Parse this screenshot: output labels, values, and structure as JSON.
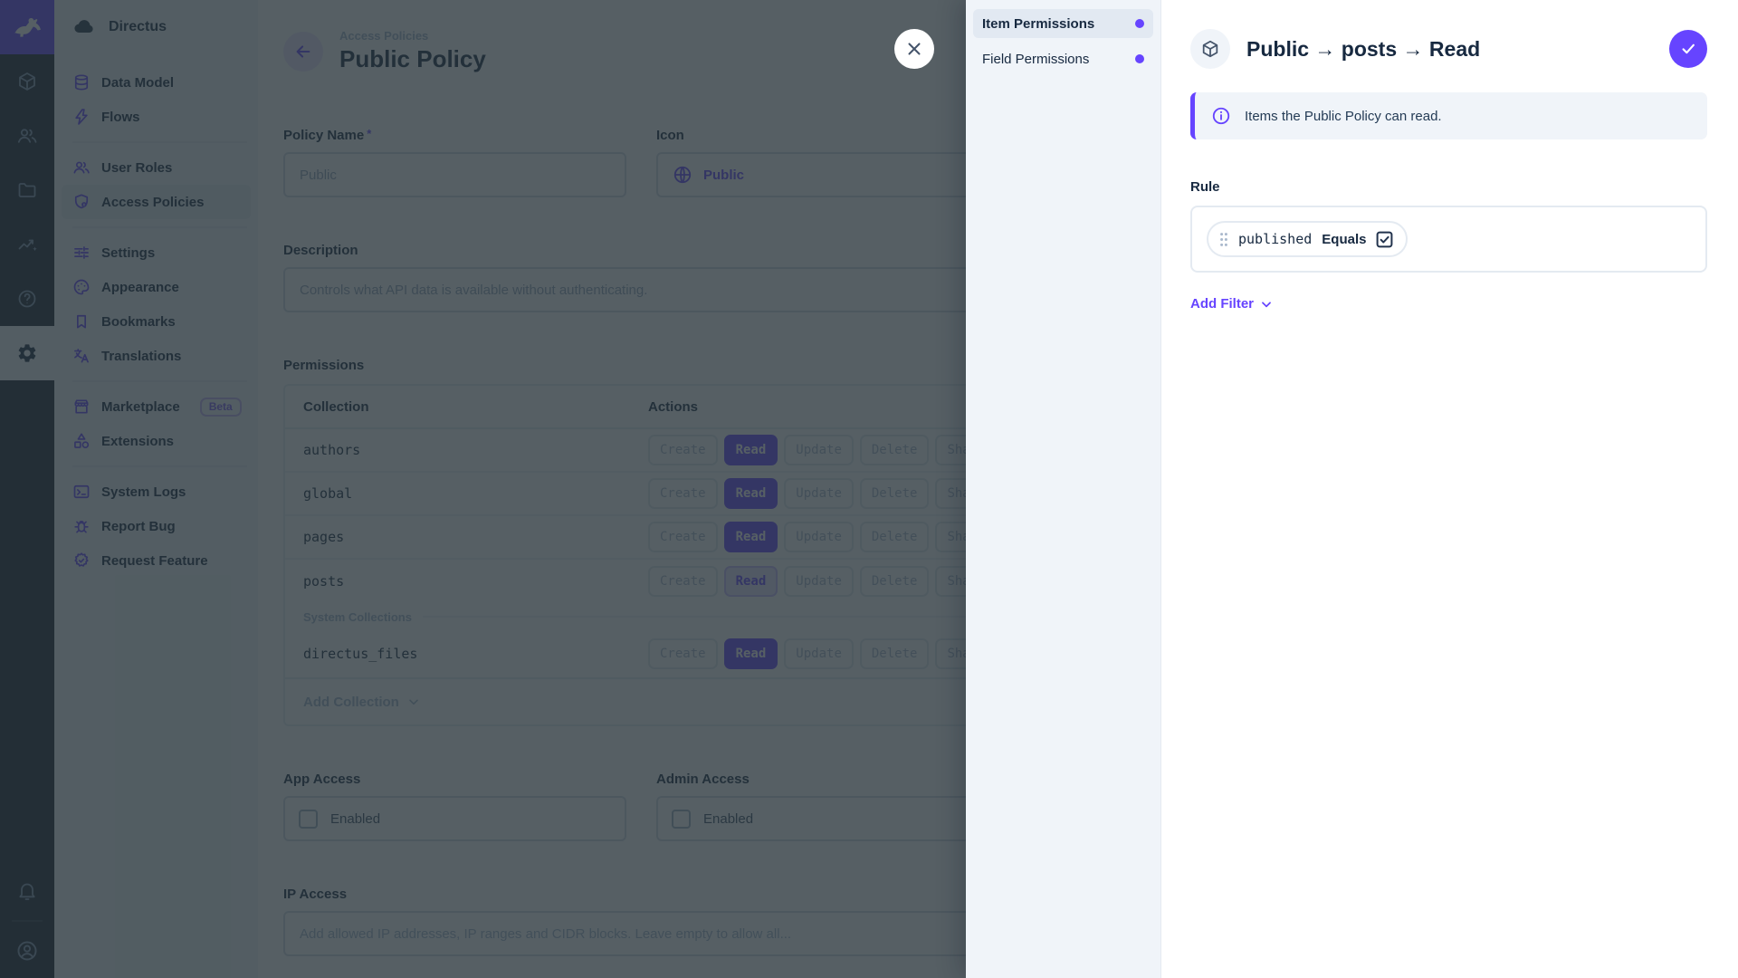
{
  "app": {
    "project_name": "Directus"
  },
  "nav": {
    "items": [
      {
        "label": "Data Model",
        "icon": "database-icon"
      },
      {
        "label": "Flows",
        "icon": "bolt-icon"
      },
      {
        "label": "User Roles",
        "icon": "users-icon"
      },
      {
        "label": "Access Policies",
        "icon": "shield-lock-icon",
        "active": true
      },
      {
        "label": "Settings",
        "icon": "tune-icon"
      },
      {
        "label": "Appearance",
        "icon": "palette-icon"
      },
      {
        "label": "Bookmarks",
        "icon": "bookmark-icon"
      },
      {
        "label": "Translations",
        "icon": "translate-icon"
      },
      {
        "label": "Marketplace",
        "icon": "storefront-icon",
        "badge": "Beta"
      },
      {
        "label": "Extensions",
        "icon": "category-icon"
      },
      {
        "label": "System Logs",
        "icon": "terminal-icon"
      },
      {
        "label": "Report Bug",
        "icon": "bug-icon"
      },
      {
        "label": "Request Feature",
        "icon": "feature-seal-icon"
      }
    ]
  },
  "module_bar": {
    "icons": [
      "directus-rabbit-logo",
      "cube-icon",
      "users-icon",
      "folder-icon",
      "insights-icon",
      "help-icon",
      "settings-gear-icon",
      "bell-icon",
      "avatar-icon"
    ],
    "selected_module": "settings"
  },
  "page": {
    "breadcrumb": "Access Policies",
    "title": "Public Policy"
  },
  "form": {
    "policy_name": {
      "label": "Policy Name",
      "required_mark": "*",
      "value": "Public"
    },
    "icon": {
      "label": "Icon",
      "value": "Public",
      "glyph": "globe-icon"
    },
    "description": {
      "label": "Description",
      "value": "Controls what API data is available without authenticating."
    },
    "permissions": {
      "label": "Permissions",
      "columns": [
        "Collection",
        "Actions"
      ],
      "actions": [
        "Create",
        "Read",
        "Update",
        "Delete",
        "Share"
      ],
      "rows": [
        {
          "collection": "authors",
          "read_state": "full"
        },
        {
          "collection": "global",
          "read_state": "full"
        },
        {
          "collection": "pages",
          "read_state": "full"
        },
        {
          "collection": "posts",
          "read_state": "custom"
        }
      ],
      "system_divider": "System Collections",
      "system_rows": [
        {
          "collection": "directus_files",
          "read_state": "full"
        }
      ],
      "add_collection": "Add Collection"
    },
    "app_access": {
      "label": "App Access",
      "checkbox_label": "Enabled",
      "checked": false
    },
    "admin_access": {
      "label": "Admin Access",
      "checkbox_label": "Enabled",
      "checked": false
    },
    "ip_access": {
      "label": "IP Access",
      "placeholder": "Add allowed IP addresses, IP ranges and CIDR blocks. Leave empty to allow all..."
    }
  },
  "drawer": {
    "tabs": [
      {
        "label": "Item Permissions",
        "active": true
      },
      {
        "label": "Field Permissions",
        "active": false
      }
    ],
    "title": "Public → posts → Read",
    "notice": "Items the Public Policy can read.",
    "rule": {
      "label": "Rule",
      "filter": {
        "field": "published",
        "operator": "Equals",
        "value_checked": true
      },
      "add_filter": "Add Filter"
    }
  },
  "colors": {
    "primary": "#6644ff",
    "text_dark": "#172940",
    "placeholder": "#a2b5cd",
    "panel_background": "#f0f4f9",
    "module_bar_background": "#18222f",
    "border": "#e4eaf1"
  }
}
